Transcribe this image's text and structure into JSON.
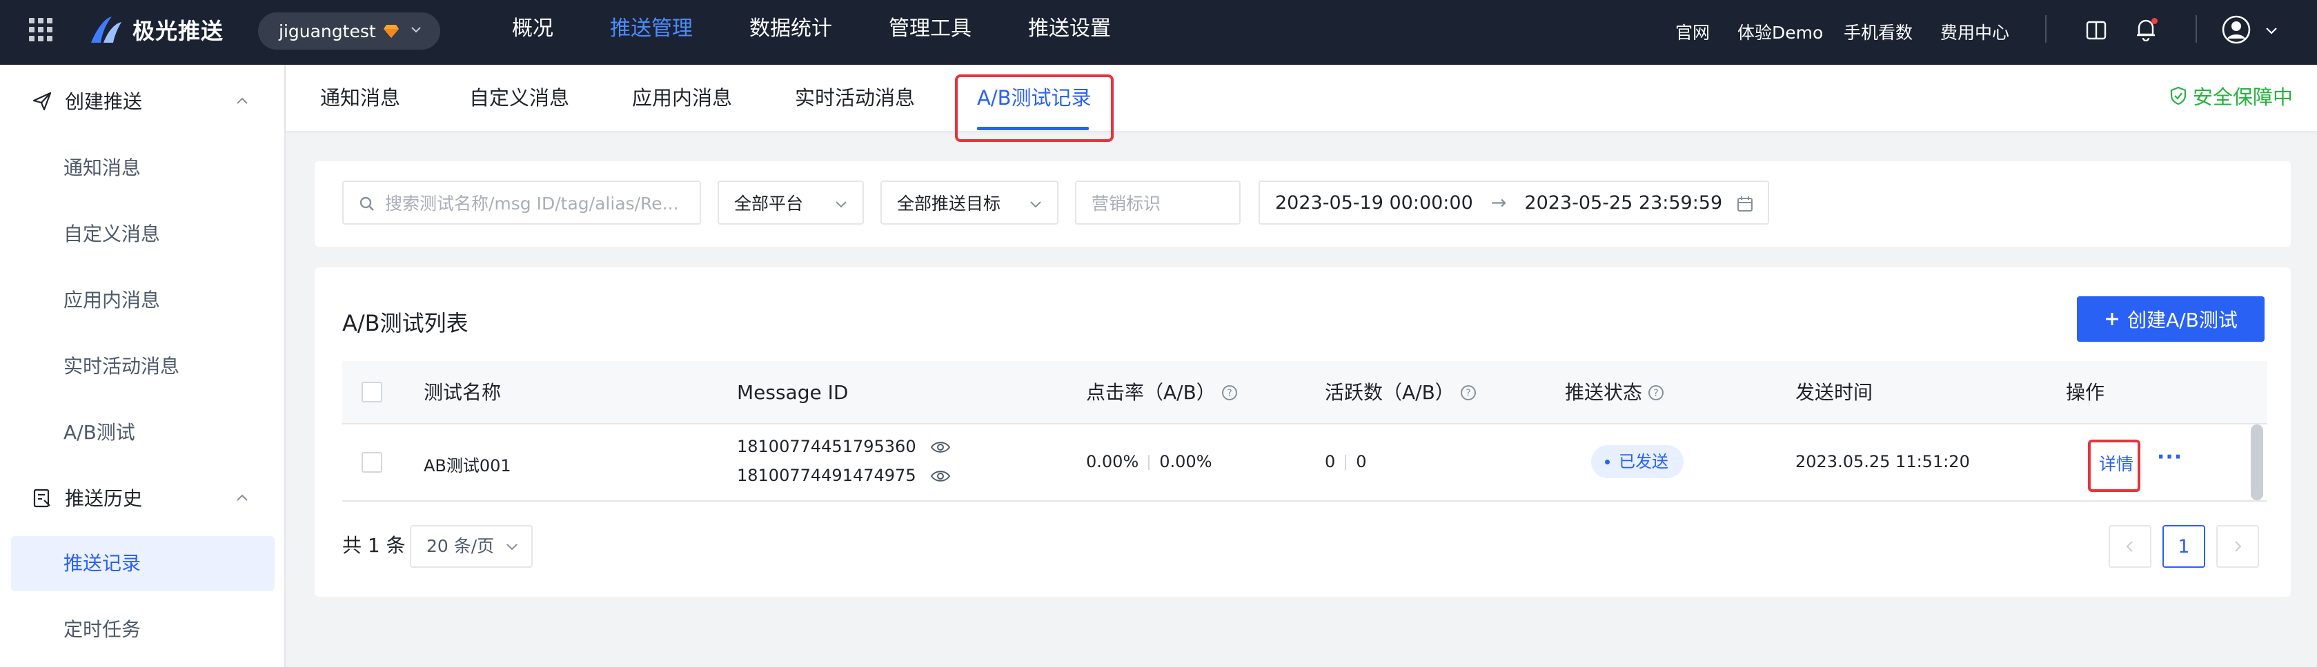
{
  "topbar": {
    "brand": "极光推送",
    "app_name": "jiguangtest",
    "nav": [
      "概况",
      "推送管理",
      "数据统计",
      "管理工具",
      "推送设置"
    ],
    "active_nav": "推送管理",
    "links": {
      "official": "官网",
      "demo": "体验Demo",
      "mobile": "手机看数",
      "billing": "费用中心"
    }
  },
  "sidebar": {
    "groups": [
      {
        "label": "创建推送",
        "items": [
          "通知消息",
          "自定义消息",
          "应用内消息",
          "实时活动消息",
          "A/B测试"
        ]
      },
      {
        "label": "推送历史",
        "items": [
          "推送记录",
          "定时任务"
        ]
      }
    ],
    "active_item": "推送记录"
  },
  "tabs": {
    "items": [
      "通知消息",
      "自定义消息",
      "应用内消息",
      "实时活动消息",
      "A/B测试记录"
    ],
    "active": "A/B测试记录",
    "security": "安全保障中"
  },
  "filters": {
    "search_placeholder": "搜索测试名称/msg ID/tag/alias/Re...",
    "platform": "全部平台",
    "target": "全部推送目标",
    "marketing_placeholder": "营销标识",
    "date_start": "2023-05-19 00:00:00",
    "date_arrow": "→",
    "date_end": "2023-05-25 23:59:59"
  },
  "list": {
    "title": "A/B测试列表",
    "create_button": "创建A/B测试",
    "columns": {
      "name": "测试名称",
      "msgid": "Message ID",
      "ctr": "点击率（A/B）",
      "active": "活跃数（A/B）",
      "status": "推送状态",
      "time": "发送时间",
      "ops": "操作"
    },
    "rows": [
      {
        "name": "AB测试001",
        "msgid_a": "18100774451795360",
        "msgid_b": "18100774491474975",
        "ctr_a": "0.00%",
        "ctr_b": "0.00%",
        "active_a": "0",
        "active_b": "0",
        "status": "已发送",
        "time": "2023.05.25 11:51:20",
        "detail": "详情",
        "more": "···"
      }
    ],
    "total": "共 1 条",
    "page_size": "20 条/页",
    "current_page": "1"
  },
  "colors": {
    "primary": "#2a61f5",
    "nav_bg": "#1b2232",
    "highlight": "#e8323c",
    "security": "#25b33e"
  }
}
